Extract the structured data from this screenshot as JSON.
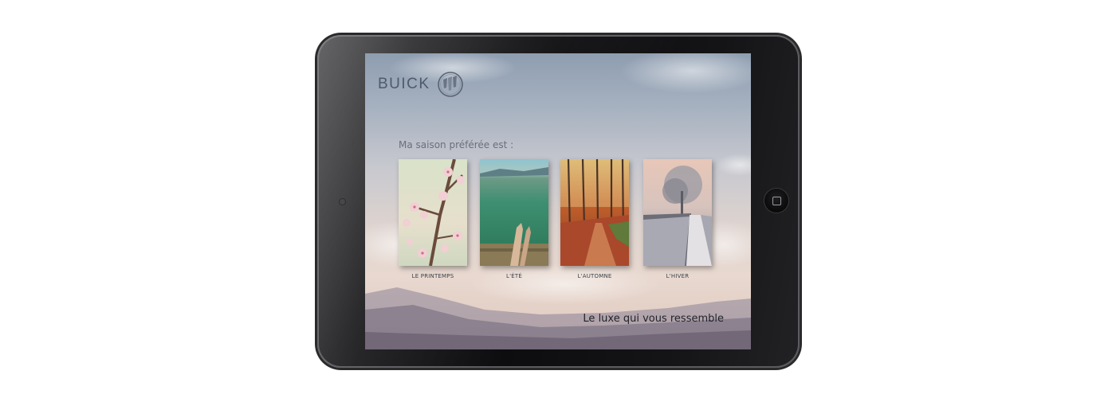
{
  "app": {
    "brand": "BUICK",
    "prompt": "Ma saison préférée est :",
    "tagline": "Le luxe qui vous ressemble"
  },
  "seasons": [
    {
      "label": "LE PRINTEMPS",
      "icon": "spring-blossom-photo"
    },
    {
      "label": "L'ÉTÉ",
      "icon": "summer-lake-photo"
    },
    {
      "label": "L'AUTOMNE",
      "icon": "autumn-forest-photo"
    },
    {
      "label": "L'HIVER",
      "icon": "winter-path-photo"
    }
  ],
  "device": {
    "type": "tablet",
    "home_button_icon": "home-button-icon"
  },
  "colors": {
    "brand_text": "#4f5a6b",
    "prompt_text": "#6a6f7c",
    "tagline_text": "#1f222a",
    "device_body": "#0d0d0f"
  }
}
